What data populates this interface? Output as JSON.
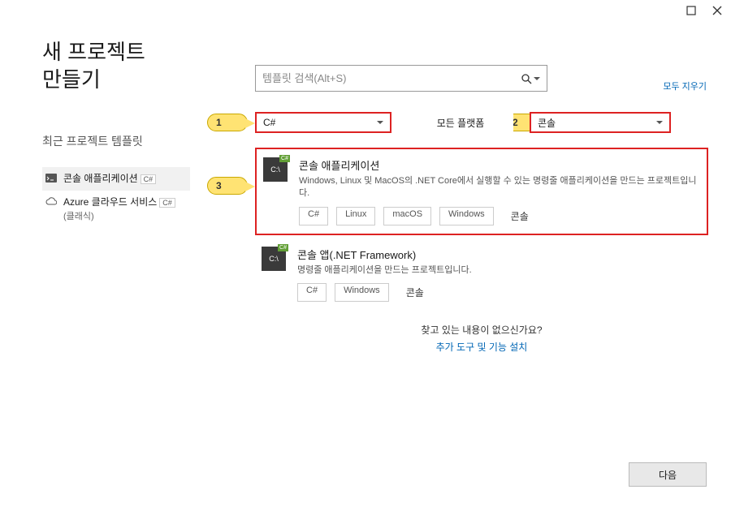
{
  "window": {
    "title_line1": "새 프로젝트",
    "title_line2": "만들기"
  },
  "search": {
    "placeholder": "템플릿 검색(Alt+S)"
  },
  "clear_all_label": "모두 지우기",
  "recent": {
    "heading": "최근 프로젝트 템플릿",
    "items": [
      {
        "name": "콘솔 애플리케이션",
        "lang": "C#",
        "sub": ""
      },
      {
        "name": "Azure 클라우드 서비스",
        "lang": "C#",
        "sub": "(클래식)"
      }
    ]
  },
  "filters": {
    "language": "C#",
    "platform": "모든 플랫폼",
    "type": "콘솔"
  },
  "callouts": {
    "c1": "1",
    "c2": "2",
    "c3": "3"
  },
  "templates": [
    {
      "title": "콘솔 애플리케이션",
      "desc": "Windows, Linux 및 MacOS의 .NET Core에서 실행할 수 있는 명령줄 애플리케이션을 만드는 프로젝트입니다.",
      "tags_boxed": [
        "C#",
        "Linux",
        "macOS",
        "Windows"
      ],
      "tag_accent": "콘솔",
      "highlight": true
    },
    {
      "title": "콘솔 앱(.NET Framework)",
      "desc": "명령줄 애플리케이션을 만드는 프로젝트입니다.",
      "tags_boxed": [
        "C#",
        "Windows"
      ],
      "tag_accent": "콘솔",
      "highlight": false
    }
  ],
  "footer": {
    "question": "찾고 있는 내용이 없으신가요?",
    "link": "추가 도구 및 기능 설치"
  },
  "next_button": "다음"
}
